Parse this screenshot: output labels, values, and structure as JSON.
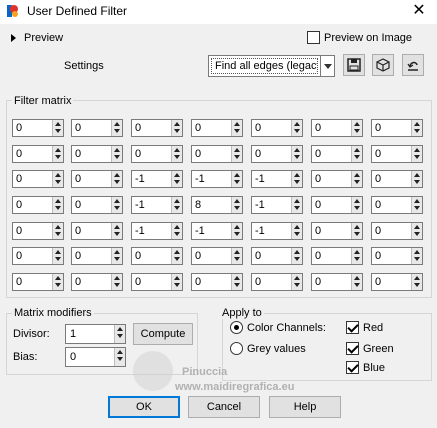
{
  "window": {
    "title": "User Defined Filter",
    "close_glyph": "✕"
  },
  "preview": {
    "label": "Preview",
    "preview_on_image_label": "Preview on Image",
    "preview_on_image_checked": false
  },
  "settings": {
    "label": "Settings",
    "preset_value": "Find all edges (legacy)",
    "icons": [
      "save-icon",
      "cube-icon",
      "reset-icon"
    ]
  },
  "filter_matrix": {
    "label": "Filter matrix",
    "rows": [
      [
        "0",
        "0",
        "0",
        "0",
        "0",
        "0",
        "0"
      ],
      [
        "0",
        "0",
        "0",
        "0",
        "0",
        "0",
        "0"
      ],
      [
        "0",
        "0",
        "-1",
        "-1",
        "-1",
        "0",
        "0"
      ],
      [
        "0",
        "0",
        "-1",
        "8",
        "-1",
        "0",
        "0"
      ],
      [
        "0",
        "0",
        "-1",
        "-1",
        "-1",
        "0",
        "0"
      ],
      [
        "0",
        "0",
        "0",
        "0",
        "0",
        "0",
        "0"
      ],
      [
        "0",
        "0",
        "0",
        "0",
        "0",
        "0",
        "0"
      ]
    ]
  },
  "matrix_modifiers": {
    "label": "Matrix modifiers",
    "divisor_label": "Divisor:",
    "divisor_value": "1",
    "bias_label": "Bias:",
    "bias_value": "0",
    "compute_label": "Compute"
  },
  "apply_to": {
    "label": "Apply to",
    "color_channels_label": "Color Channels:",
    "color_channels_selected": true,
    "grey_values_label": "Grey values",
    "grey_values_selected": false,
    "red_label": "Red",
    "red_checked": true,
    "green_label": "Green",
    "green_checked": true,
    "blue_label": "Blue",
    "blue_checked": true
  },
  "buttons": {
    "ok": "OK",
    "cancel": "Cancel",
    "help": "Help"
  },
  "watermark": {
    "name": "Pinuccia",
    "site": "www.maidiregrafica.eu"
  }
}
